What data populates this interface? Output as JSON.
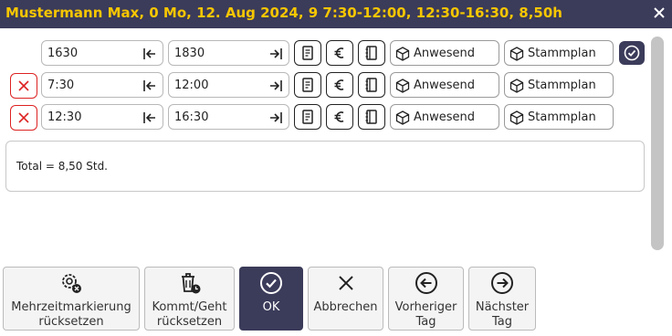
{
  "window": {
    "title": "Mustermann Max, 0 Mo, 12. Aug 2024, 9 7:30-12:00, 12:30-16:30, 8,50h",
    "accent_color": "#f7c600",
    "header_color": "#3b3b5a"
  },
  "rows": [
    {
      "start": "1630",
      "end": "1830",
      "tag1": "Anwesend",
      "tag2": "Stammplan"
    },
    {
      "start": "7:30",
      "end": "12:00",
      "tag1": "Anwesend",
      "tag2": "Stammplan"
    },
    {
      "start": "12:30",
      "end": "16:30",
      "tag1": "Anwesend",
      "tag2": "Stammplan"
    }
  ],
  "total": "Total = 8,50 Std.",
  "buttons": {
    "reset_multi": "Mehrzeitmarkierung rücksetzen",
    "reset_inout": "Kommt/Geht rücksetzen",
    "ok": "OK",
    "cancel": "Abbrechen",
    "prev_day": "Vorheriger Tag",
    "next_day": "Nächster Tag"
  }
}
